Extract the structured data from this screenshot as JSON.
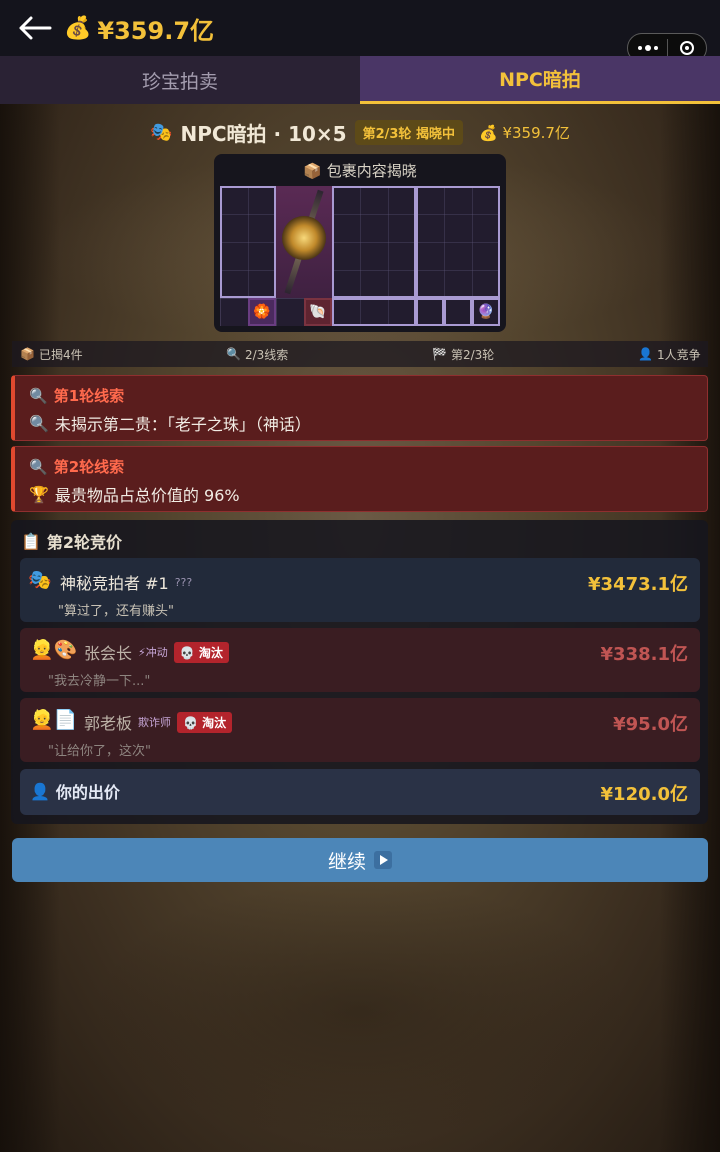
{
  "topbar": {
    "money_icon": "money-bag-icon",
    "money": "¥359.7亿"
  },
  "tabs": [
    {
      "label": "珍宝拍卖",
      "active": false
    },
    {
      "label": "NPC暗拍",
      "active": true
    }
  ],
  "header": {
    "title": "NPC暗拍 · 10×5",
    "round_badge": "第2/3轮 揭晓中",
    "money": "¥359.7亿"
  },
  "package": {
    "title": "包裹内容揭晓"
  },
  "stats": {
    "revealed": "已揭4件",
    "clues": "2/3线索",
    "round": "第2/3轮",
    "competitors": "1人竞争"
  },
  "clues": [
    {
      "title": "第1轮线索",
      "icon": "search-icon",
      "text": "未揭示第二贵：「老子之珠」（神话）"
    },
    {
      "title": "第2轮线索",
      "icon": "trophy-icon",
      "text": "最贵物品占总价值的 96%"
    }
  ],
  "bidding": {
    "title": "第2轮竞价",
    "rows": [
      {
        "name": "神秘竞拍者 #1",
        "tag": "???",
        "quote": "\"算过了，还有赚头\"",
        "price": "¥3473.1亿",
        "status": "active"
      },
      {
        "name": "张会长",
        "trait": "⚡冲动",
        "badge": "淘汰",
        "quote": "\"我去冷静一下...\"",
        "price": "¥338.1亿",
        "status": "out"
      },
      {
        "name": "郭老板",
        "trait": "欺诈师",
        "badge": "淘汰",
        "quote": "\"让给你了，这次\"",
        "price": "¥95.0亿",
        "status": "out"
      }
    ],
    "mine": {
      "label": "你的出价",
      "price": "¥120.0亿"
    }
  },
  "actions": {
    "continue": "继续"
  },
  "colors": {
    "accent": "#f3c13a",
    "tab_active": "#4a3666",
    "clue_bg": "#5a1d1d",
    "button": "#4c86b8"
  }
}
